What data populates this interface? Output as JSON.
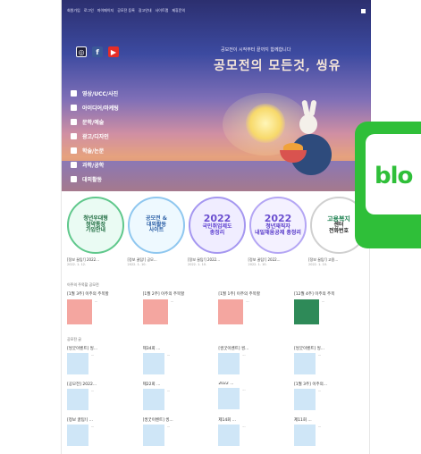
{
  "hero": {
    "topnav": [
      "회원가입",
      "로그인",
      "마이페이지",
      "공모전 등록",
      "광고안내",
      "사이트맵",
      "제휴문의"
    ],
    "tagline": "공모전이 시작부터 끝까지 함께합니다",
    "headline": "공모전의 모든것, 씽유"
  },
  "social": [
    "instagram-icon",
    "facebook-icon",
    "youtube-icon"
  ],
  "sidenav": [
    {
      "icon": "video-icon",
      "label": "영상/UCC/사진"
    },
    {
      "icon": "idea-icon",
      "label": "아이디어/마케팅"
    },
    {
      "icon": "book-icon",
      "label": "문학/예술"
    },
    {
      "icon": "design-icon",
      "label": "광고/디자인"
    },
    {
      "icon": "pen-icon",
      "label": "학술/논문"
    },
    {
      "icon": "science-icon",
      "label": "과학/공학"
    },
    {
      "icon": "people-icon",
      "label": "대외활동"
    }
  ],
  "circles": [
    {
      "top": "청년우대형",
      "big": "청약통장",
      "bottom": "가입안내"
    },
    {
      "top": "공모전 &",
      "big": "대외활동",
      "bottom": "사이트"
    },
    {
      "top": "2022",
      "big": "국민취업제도",
      "bottom": "총정리"
    },
    {
      "top": "2022",
      "big": "청년재직자",
      "bottom": "내일채움공제 총정리"
    },
    {
      "top": "고용복지",
      "big": "센터",
      "bottom": "전화번호"
    }
  ],
  "captions": [
    {
      "title": "[정보 꿀팁!] 2022...",
      "date": "2022. 1. 12."
    },
    {
      "title": "[정보 꿀팁!] 공모...",
      "date": "2022. 1. 10."
    },
    {
      "title": "[정보 꿀팁!] 2022...",
      "date": "2022. 1. 10."
    },
    {
      "title": "[정보 꿀팁!] 2022...",
      "date": "2022. 1. 10."
    },
    {
      "title": "[정보 꿀팁!] 고용...",
      "date": "2022. 1. 10."
    }
  ],
  "section1": {
    "title": "이주의 주목할 공모전",
    "cards": [
      {
        "title": "[1월 3주] 이주의 주목할",
        "text": "..."
      },
      {
        "title": "[1월 2주] 이주의 주목할",
        "text": "..."
      },
      {
        "title": "[1월 1주] 이주의 주목할",
        "text": "..."
      },
      {
        "title": "[12월 4주] 이주의 주목",
        "text": "..."
      }
    ]
  },
  "section2": {
    "title": "공모전 글",
    "items": [
      {
        "title": "[씽굿이벤트] 씽...",
        "text": "..."
      },
      {
        "title": "제34회 ...",
        "text": "..."
      },
      {
        "title": "[씽굿이벤트] 씽...",
        "text": "..."
      },
      {
        "title": "[씽굿이벤트] 씽...",
        "text": "..."
      },
      {
        "title": "[공모전] 2022...",
        "text": "..."
      },
      {
        "title": "제22회 ...",
        "text": "..."
      },
      {
        "title": "2022 ...",
        "text": "..."
      },
      {
        "title": "[1월 3주] 이주의...",
        "text": "..."
      },
      {
        "title": "[정보 꿀팁!] ...",
        "text": "..."
      },
      {
        "title": "[씽굿이벤트] 씽...",
        "text": "..."
      },
      {
        "title": "제14회 ...",
        "text": "..."
      },
      {
        "title": "제11회 ...",
        "text": "..."
      }
    ]
  },
  "badge": {
    "word": "blo"
  },
  "colors": {
    "brand_green": "#2fbf39",
    "hero_top": "#2c2f6f"
  }
}
